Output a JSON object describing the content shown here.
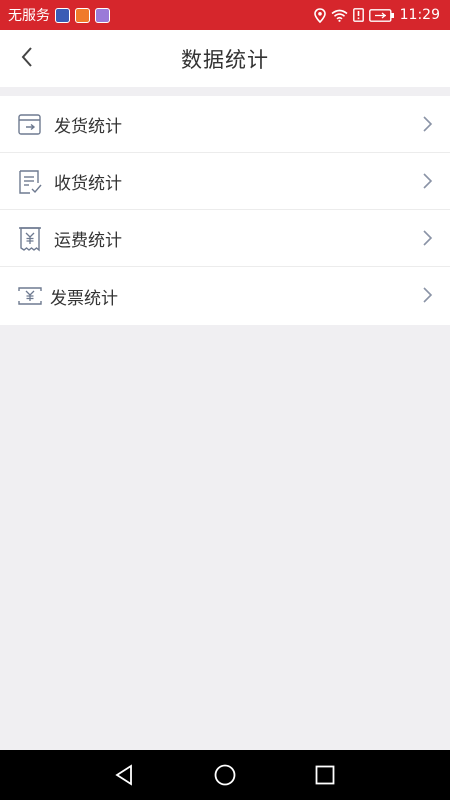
{
  "status_bar": {
    "carrier": "无服务",
    "time": "11:29",
    "icons": [
      "shield-app-icon",
      "video-app-icon",
      "music-app-icon",
      "location-icon",
      "wifi-icon",
      "alert-icon",
      "battery-charging-icon"
    ]
  },
  "header": {
    "title": "数据统计",
    "back_icon": "chevron-left-icon"
  },
  "list": {
    "items": [
      {
        "label": "发货统计",
        "icon": "shipment-send-icon"
      },
      {
        "label": "收货统计",
        "icon": "receipt-document-icon"
      },
      {
        "label": "运费统计",
        "icon": "freight-yuan-receipt-icon"
      },
      {
        "label": "发票统计",
        "icon": "invoice-yuan-icon"
      }
    ]
  },
  "nav": {
    "buttons": [
      "back-triangle-icon",
      "home-circle-icon",
      "recents-square-icon"
    ]
  },
  "colors": {
    "status_bar": "#d6262c",
    "background": "#f0eff2",
    "icon_stroke": "#6e7a90"
  }
}
